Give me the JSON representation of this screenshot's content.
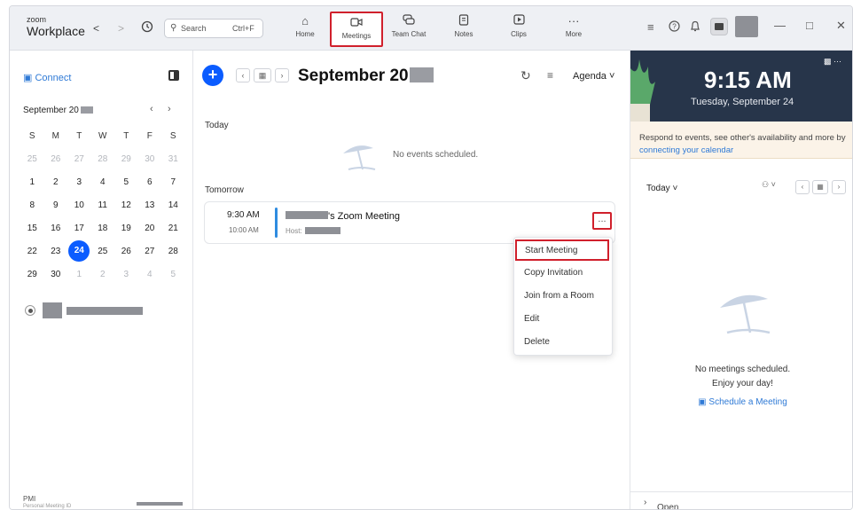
{
  "app": {
    "brand_top": "zoom",
    "brand_bottom": "Workplace"
  },
  "toolbar": {
    "back": "<",
    "forward": ">",
    "search_label": "Search",
    "search_shortcut": "Ctrl+F",
    "tabs": [
      {
        "label": "Home",
        "icon": "home-icon"
      },
      {
        "label": "Meetings",
        "icon": "camera-icon",
        "active": true
      },
      {
        "label": "Team Chat",
        "icon": "chat-icon"
      },
      {
        "label": "Notes",
        "icon": "notes-icon"
      },
      {
        "label": "Clips",
        "icon": "clips-icon"
      },
      {
        "label": "More",
        "icon": "more-icon"
      }
    ],
    "highlight_color": "#d0202c"
  },
  "sidebar": {
    "connect": "Connect",
    "month_label": "September 20",
    "weekdays": [
      "S",
      "M",
      "T",
      "W",
      "T",
      "F",
      "S"
    ],
    "weeks": [
      [
        "25",
        "26",
        "27",
        "28",
        "29",
        "30",
        "31"
      ],
      [
        "1",
        "2",
        "3",
        "4",
        "5",
        "6",
        "7"
      ],
      [
        "8",
        "9",
        "10",
        "11",
        "12",
        "13",
        "14"
      ],
      [
        "15",
        "16",
        "17",
        "18",
        "19",
        "20",
        "21"
      ],
      [
        "22",
        "23",
        "24",
        "25",
        "26",
        "27",
        "28"
      ],
      [
        "29",
        "30",
        "1",
        "2",
        "3",
        "4",
        "5"
      ]
    ],
    "selected_day": "24",
    "pmi_label": "PMI",
    "pmi_sub": "Personal Meeting ID"
  },
  "main": {
    "title": "September 20",
    "view": "Agenda",
    "today_label": "Today",
    "no_events": "No events scheduled.",
    "tomorrow_label": "Tomorrow",
    "meeting": {
      "start": "9:30 AM",
      "end": "10:00 AM",
      "title_suffix": "'s Zoom Meeting",
      "host_label": "Host:",
      "more": "..."
    },
    "context_menu": [
      "Start Meeting",
      "Copy Invitation",
      "Join from a Room",
      "Edit",
      "Delete"
    ],
    "accent": "#0b5cff"
  },
  "right_panel": {
    "time": "9:15 AM",
    "date": "Tuesday, September 24",
    "notice_text": "Respond to events, see other's availability and more by ",
    "notice_link": "connecting your calendar",
    "today_dropdown": "Today",
    "no_meetings": "No meetings scheduled.",
    "enjoy": "Enjoy your day!",
    "schedule_link": "Schedule a Meeting",
    "open_recordings": "Open Recordings"
  }
}
